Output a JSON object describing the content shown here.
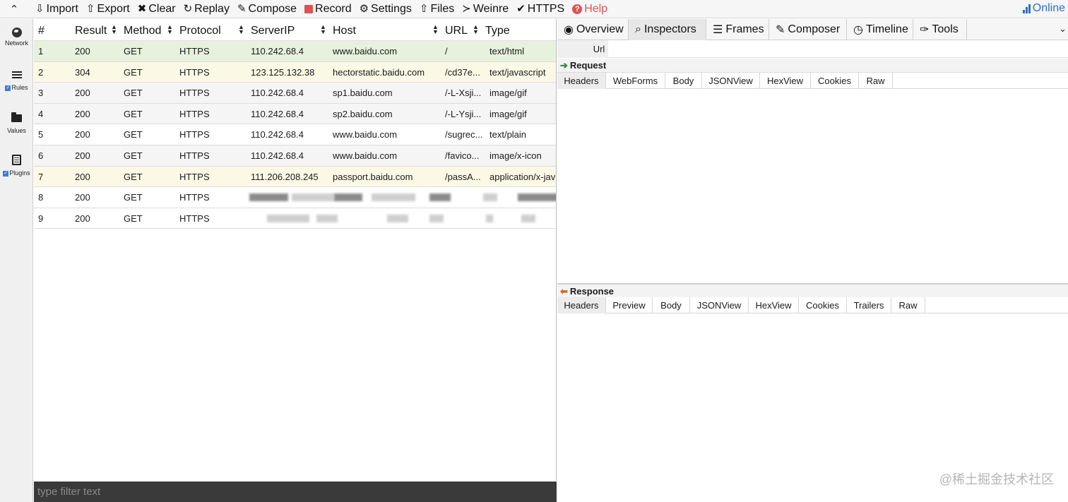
{
  "toolbar": {
    "collapse_icon": "chevron-up-icon",
    "items": [
      {
        "label": "Import",
        "icon": "import-icon",
        "glyph": "⇩"
      },
      {
        "label": "Export",
        "icon": "export-icon",
        "glyph": "⇧"
      },
      {
        "label": "Clear",
        "icon": "close-icon",
        "glyph": "✖"
      },
      {
        "label": "Replay",
        "icon": "replay-icon",
        "glyph": "↻"
      },
      {
        "label": "Compose",
        "icon": "edit-icon",
        "glyph": "✎"
      },
      {
        "label": "Record",
        "icon": "record-icon",
        "glyph": ""
      },
      {
        "label": "Settings",
        "icon": "gear-icon",
        "glyph": "⚙"
      },
      {
        "label": "Files",
        "icon": "files-icon",
        "glyph": "⇧"
      },
      {
        "label": "Weinre",
        "icon": "terminal-icon",
        "glyph": "≻"
      },
      {
        "label": "HTTPS",
        "icon": "check-icon",
        "glyph": "✔"
      },
      {
        "label": "Help",
        "icon": "help-icon",
        "glyph": "?"
      }
    ],
    "online_label": "Online",
    "record_color": "#e05252",
    "help_color": "#e05252",
    "online_color": "#2f6fc2"
  },
  "sidebar": {
    "items": [
      {
        "label": "Network",
        "icon": "globe-icon",
        "checked": false
      },
      {
        "label": "Rules",
        "icon": "list-icon",
        "checked": true
      },
      {
        "label": "Values",
        "icon": "folder-icon",
        "checked": false
      },
      {
        "label": "Plugins",
        "icon": "document-icon",
        "checked": true
      }
    ]
  },
  "grid": {
    "columns": [
      "#",
      "Result",
      "Method",
      "Protocol",
      "ServerIP",
      "Host",
      "URL",
      "Type"
    ],
    "rows": [
      {
        "n": "1",
        "result": "200",
        "method": "GET",
        "protocol": "HTTPS",
        "ip": "110.242.68.4",
        "host": "www.baidu.com",
        "url": "/",
        "type": "text/html",
        "tone": "green"
      },
      {
        "n": "2",
        "result": "304",
        "method": "GET",
        "protocol": "HTTPS",
        "ip": "123.125.132.38",
        "host": "hectorstatic.baidu.com",
        "url": "/cd37e...",
        "type": "text/javascript",
        "tone": "yellow"
      },
      {
        "n": "3",
        "result": "200",
        "method": "GET",
        "protocol": "HTTPS",
        "ip": "110.242.68.4",
        "host": "sp1.baidu.com",
        "url": "/-L-Xsji...",
        "type": "image/gif",
        "tone": "gray"
      },
      {
        "n": "4",
        "result": "200",
        "method": "GET",
        "protocol": "HTTPS",
        "ip": "110.242.68.4",
        "host": "sp2.baidu.com",
        "url": "/-L-Ysji...",
        "type": "image/gif",
        "tone": "gray"
      },
      {
        "n": "5",
        "result": "200",
        "method": "GET",
        "protocol": "HTTPS",
        "ip": "110.242.68.4",
        "host": "www.baidu.com",
        "url": "/sugrec...",
        "type": "text/plain",
        "tone": "white"
      },
      {
        "n": "6",
        "result": "200",
        "method": "GET",
        "protocol": "HTTPS",
        "ip": "110.242.68.4",
        "host": "www.baidu.com",
        "url": "/favico...",
        "type": "image/x-icon",
        "tone": "gray"
      },
      {
        "n": "7",
        "result": "200",
        "method": "GET",
        "protocol": "HTTPS",
        "ip": "111.206.208.245",
        "host": "passport.baidu.com",
        "url": "/passA...",
        "type": "application/x-jav",
        "tone": "yellow"
      },
      {
        "n": "8",
        "result": "200",
        "method": "GET",
        "protocol": "HTTPS",
        "ip": "",
        "host": "",
        "url": "",
        "type": "",
        "tone": "white"
      },
      {
        "n": "9",
        "result": "200",
        "method": "GET",
        "protocol": "HTTPS",
        "ip": "",
        "host": "",
        "url": "",
        "type": "",
        "tone": "white"
      }
    ],
    "row_colors": {
      "green": "#e8f1dd",
      "yellow": "#fbf9e6",
      "gray": "#f5f5f5",
      "white": "#ffffff"
    }
  },
  "filter": {
    "placeholder": "type filter text"
  },
  "right_tabs": [
    {
      "label": "Overview",
      "icon": "eye-icon",
      "glyph": "◉",
      "active": false
    },
    {
      "label": "Inspectors",
      "icon": "search-icon",
      "glyph": "⌕",
      "active": true
    },
    {
      "label": "Frames",
      "icon": "menu-icon",
      "glyph": "☰",
      "active": false
    },
    {
      "label": "Composer",
      "icon": "edit-icon",
      "glyph": "✎",
      "active": false
    },
    {
      "label": "Timeline",
      "icon": "clock-icon",
      "glyph": "◷",
      "active": false
    },
    {
      "label": "Tools",
      "icon": "wrench-icon",
      "glyph": "✑",
      "active": false
    }
  ],
  "inspector": {
    "url_label": "Url",
    "request_title": "Request",
    "request_tabs": [
      "Headers",
      "WebForms",
      "Body",
      "JSONView",
      "HexView",
      "Cookies",
      "Raw"
    ],
    "response_title": "Response",
    "response_tabs": [
      "Headers",
      "Preview",
      "Body",
      "JSONView",
      "HexView",
      "Cookies",
      "Trailers",
      "Raw"
    ]
  },
  "watermark": "@稀土掘金技术社区"
}
